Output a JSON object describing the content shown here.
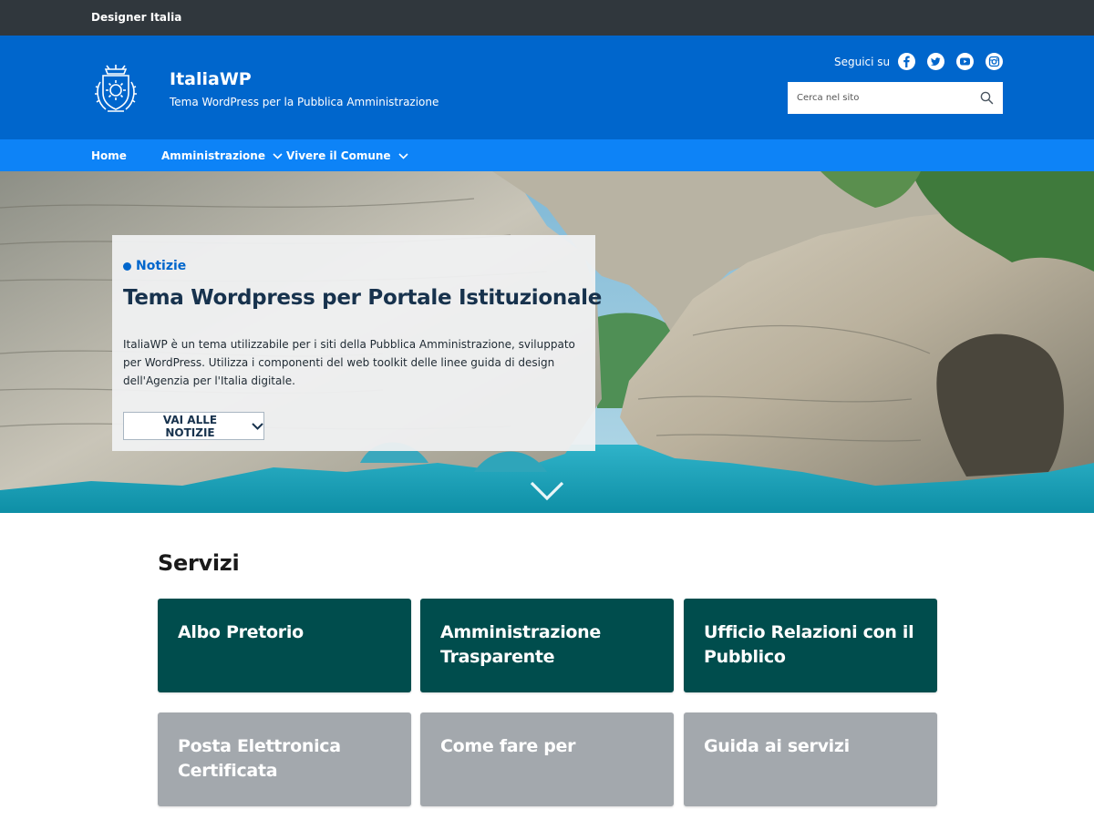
{
  "topbar": {
    "org_name": "Designer Italia"
  },
  "header": {
    "site_name": "ItaliaWP",
    "tagline": "Tema WordPress per la Pubblica Amministrazione",
    "follow_label": "Seguici su",
    "social_icons": [
      "facebook-icon",
      "twitter-icon",
      "youtube-icon",
      "instagram-icon"
    ],
    "search_placeholder": "Cerca nel sito",
    "colors": {
      "topbar": "#30373d",
      "header": "#0066cc",
      "nav": "#0d83f7"
    }
  },
  "nav": {
    "items": [
      {
        "label": "Home",
        "has_dropdown": false
      },
      {
        "label": "Amministrazione",
        "has_dropdown": true
      },
      {
        "label": "Vivere il Comune",
        "has_dropdown": true
      }
    ]
  },
  "hero": {
    "kicker": "Notizie",
    "title": "Tema Wordpress per Portale Istituzionale",
    "text": "ItaliaWP è un tema utilizzabile per i siti della Pubblica Amministrazione, sviluppato per WordPress. Utilizza i componenti del web toolkit delle linee guida di design dell'Agenzia per l'Italia digitale.",
    "button_label": "VAI ALLE NOTIZIE"
  },
  "services": {
    "title": "Servizi",
    "tiles": [
      {
        "label": "Albo Pretorio",
        "color": "#004d4d"
      },
      {
        "label": "Amministrazione Trasparente",
        "color": "#004d4d"
      },
      {
        "label": "Ufficio Relazioni con il Pubblico",
        "color": "#004d4d"
      },
      {
        "label": "Posta Elettronica Certificata",
        "color": "#a3a8ad"
      },
      {
        "label": "Come fare per",
        "color": "#a3a8ad"
      },
      {
        "label": "Guida ai servizi",
        "color": "#a3a8ad"
      }
    ]
  }
}
